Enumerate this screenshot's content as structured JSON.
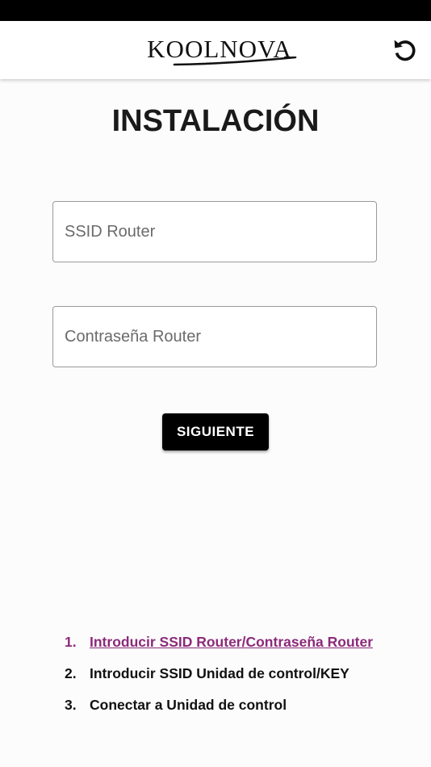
{
  "header": {
    "brand": "KOOLNOVA",
    "reset_icon": "rotate-ccw-icon"
  },
  "page": {
    "title": "INSTALACIÓN"
  },
  "form": {
    "ssid_placeholder": "SSID Router",
    "ssid_value": "",
    "password_placeholder": "Contraseña Router",
    "password_value": "",
    "next_label": "SIGUIENTE"
  },
  "steps": [
    {
      "number": "1.",
      "label": "Introducir SSID Router/Contraseña Router",
      "active": true
    },
    {
      "number": "2.",
      "label": "Introducir SSID Unidad de control/KEY",
      "active": false
    },
    {
      "number": "3.",
      "label": "Conectar a Unidad de control",
      "active": false
    }
  ],
  "colors": {
    "active_step": "#8c2a7a",
    "button_bg": "#000000",
    "status_bar": "#000000"
  }
}
